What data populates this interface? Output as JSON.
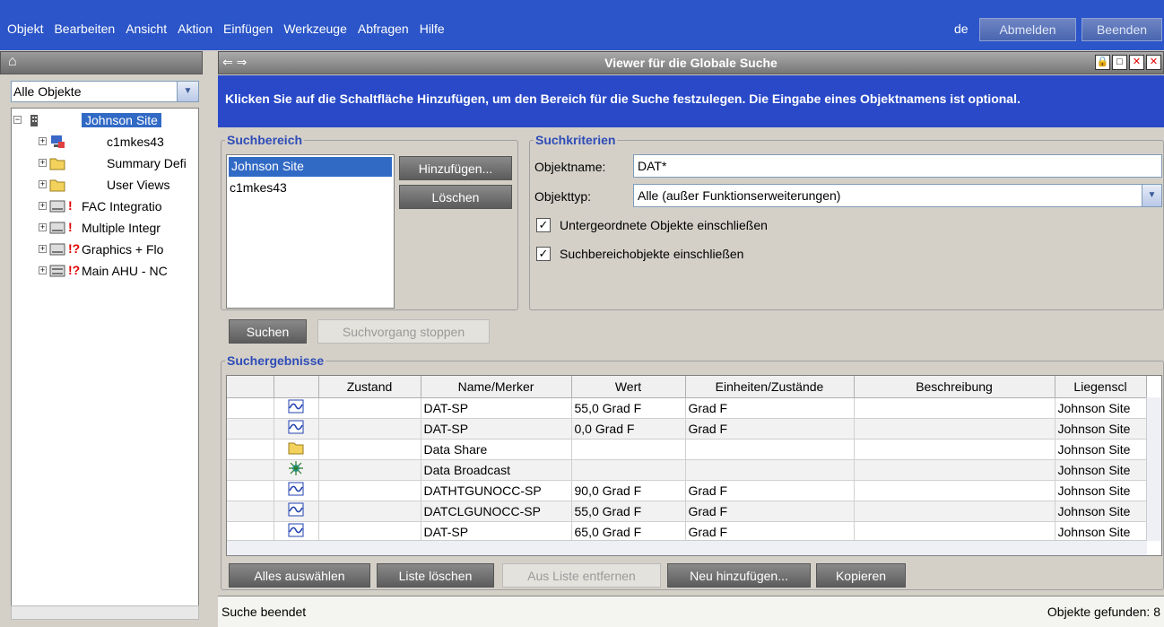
{
  "menu": {
    "items": [
      "Objekt",
      "Bearbeiten",
      "Ansicht",
      "Aktion",
      "Einfügen",
      "Werkzeuge",
      "Abfragen",
      "Hilfe"
    ],
    "language": "de",
    "logout": "Abmelden",
    "exit": "Beenden"
  },
  "left_panel": {
    "filter": "Alle Objekte",
    "tree": [
      {
        "label": "Johnson Site",
        "selected": true
      },
      {
        "label": "c1mkes43"
      },
      {
        "label": "Summary Defi"
      },
      {
        "label": "User Views"
      },
      {
        "label": "FAC Integratio",
        "flag": "!"
      },
      {
        "label": "Multiple Integr",
        "flag": "!"
      },
      {
        "label": "Graphics + Flo",
        "flag": "!?"
      },
      {
        "label": "Main AHU - NC",
        "flag": "!?"
      }
    ]
  },
  "viewer": {
    "title": "Viewer für die Globale Suche",
    "banner": "Klicken Sie auf die Schaltfläche Hinzufügen, um den Bereich für die Suche festzulegen. Die Eingabe eines Objektnamens ist optional."
  },
  "search_area": {
    "legend": "Suchbereich",
    "items": [
      "Johnson Site",
      "c1mkes43"
    ],
    "add_button": "Hinzufügen...",
    "delete_button": "Löschen"
  },
  "criteria": {
    "legend": "Suchkriterien",
    "name_label": "Objektname:",
    "name_value": "DAT*",
    "type_label": "Objekttyp:",
    "type_value": "Alle (außer Funktionserweiterungen)",
    "check1": "Untergeordnete Objekte einschließen",
    "check2": "Suchbereichobjekte einschließen"
  },
  "actions": {
    "search": "Suchen",
    "stop": "Suchvorgang stoppen"
  },
  "results": {
    "legend": "Suchergebnisse",
    "columns": [
      "",
      "",
      "Zustand",
      "Name/Merker",
      "Wert",
      "Einheiten/Zustände",
      "Beschreibung",
      "Liegenscl"
    ],
    "rows": [
      {
        "icon": "trend",
        "state": "",
        "name": "DAT-SP",
        "value": "55,0 Grad F",
        "units": "Grad F",
        "desc": "",
        "site": "Johnson Site"
      },
      {
        "icon": "trend",
        "state": "",
        "name": "DAT-SP",
        "value": "0,0 Grad F",
        "units": "Grad F",
        "desc": "",
        "site": "Johnson Site"
      },
      {
        "icon": "folder",
        "state": "",
        "name": "Data Share",
        "value": "",
        "units": "",
        "desc": "",
        "site": "Johnson Site"
      },
      {
        "icon": "broadcast",
        "state": "",
        "name": "Data Broadcast",
        "value": "",
        "units": "",
        "desc": "",
        "site": "Johnson Site"
      },
      {
        "icon": "trend",
        "state": "",
        "name": "DATHTGUNOCC-SP",
        "value": "90,0 Grad F",
        "units": "Grad F",
        "desc": "",
        "site": "Johnson Site"
      },
      {
        "icon": "trend",
        "state": "",
        "name": "DATCLGUNOCC-SP",
        "value": "55,0 Grad F",
        "units": "Grad F",
        "desc": "",
        "site": "Johnson Site"
      },
      {
        "icon": "trend",
        "state": "",
        "name": "DAT-SP",
        "value": "65,0 Grad F",
        "units": "Grad F",
        "desc": "",
        "site": "Johnson Site"
      }
    ]
  },
  "bottom_buttons": {
    "select_all": "Alles auswählen",
    "clear_list": "Liste löschen",
    "remove": "Aus Liste entfernen",
    "add_new": "Neu hinzufügen...",
    "copy": "Kopieren"
  },
  "status": {
    "left": "Suche beendet",
    "right": "Objekte gefunden: 8"
  }
}
